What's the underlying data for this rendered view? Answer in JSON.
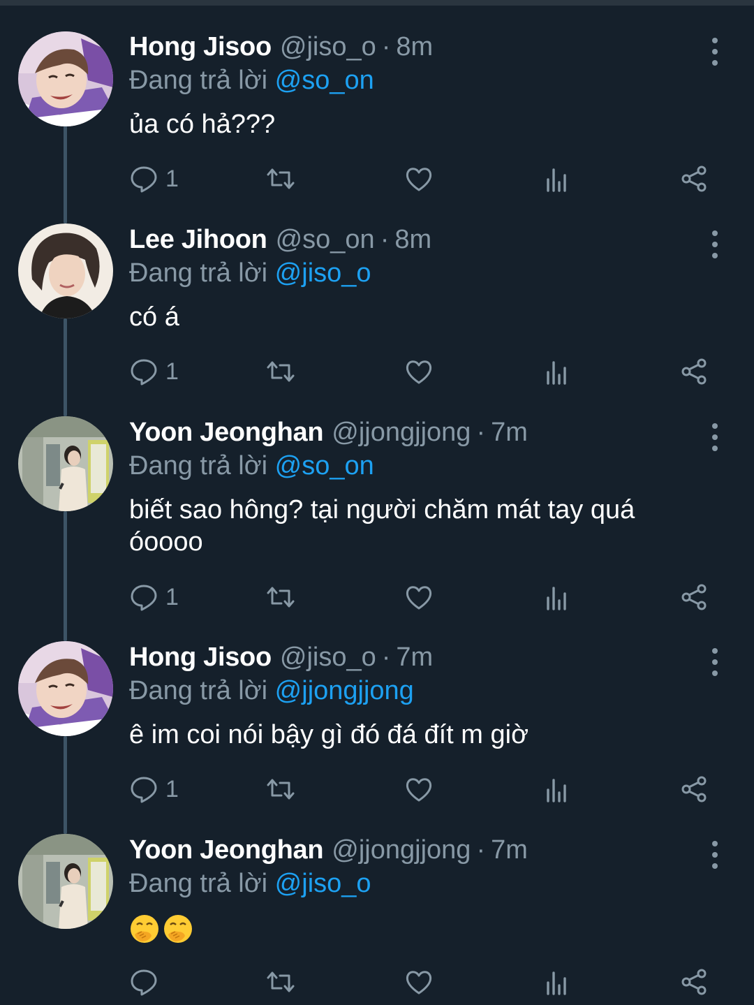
{
  "tweets": [
    {
      "name": "Hong Jisoo",
      "handle": "@jiso_o",
      "separator": "·",
      "time": "8m",
      "reply_prefix": "Đang trả lời",
      "reply_to": "@so_on",
      "text": "ủa có hả???",
      "reply_count": "1",
      "avatar": "avatar-photo-jisoo"
    },
    {
      "name": "Lee Jihoon",
      "handle": "@so_on",
      "separator": "·",
      "time": "8m",
      "reply_prefix": "Đang trả lời",
      "reply_to": "@jiso_o",
      "text": "có á",
      "reply_count": "1",
      "avatar": "avatar-photo-jihoon"
    },
    {
      "name": "Yoon Jeonghan",
      "handle": "@jjongjjong",
      "separator": "·",
      "time": "7m",
      "reply_prefix": "Đang trả lời",
      "reply_to": "@so_on",
      "text": "biết sao hông? tại người chăm mát tay quá óoooo",
      "reply_count": "1",
      "avatar": "avatar-photo-jeonghan"
    },
    {
      "name": "Hong Jisoo",
      "handle": "@jiso_o",
      "separator": "·",
      "time": "7m",
      "reply_prefix": "Đang trả lời",
      "reply_to": "@jjongjjong",
      "text": "ê im coi nói bậy gì đó đá đít m giờ",
      "reply_count": "1",
      "avatar": "avatar-photo-jisoo"
    },
    {
      "name": "Yoon Jeonghan",
      "handle": "@jjongjjong",
      "separator": "·",
      "time": "7m",
      "reply_prefix": "Đang trả lời",
      "reply_to": "@jiso_o",
      "text_emoji": [
        "face-with-hand-over-mouth",
        "face-with-hand-over-mouth"
      ],
      "reply_count": "",
      "avatar": "avatar-photo-jeonghan"
    }
  ],
  "icons": {
    "reply": "reply-icon",
    "retweet": "retweet-icon",
    "like": "like-icon",
    "analytics": "analytics-icon",
    "share": "share-icon",
    "more": "more-options-icon"
  },
  "colors": {
    "background": "#15202b",
    "secondary_text": "#8899a6",
    "mention": "#1da1f2",
    "thread_line": "#3d5466"
  }
}
